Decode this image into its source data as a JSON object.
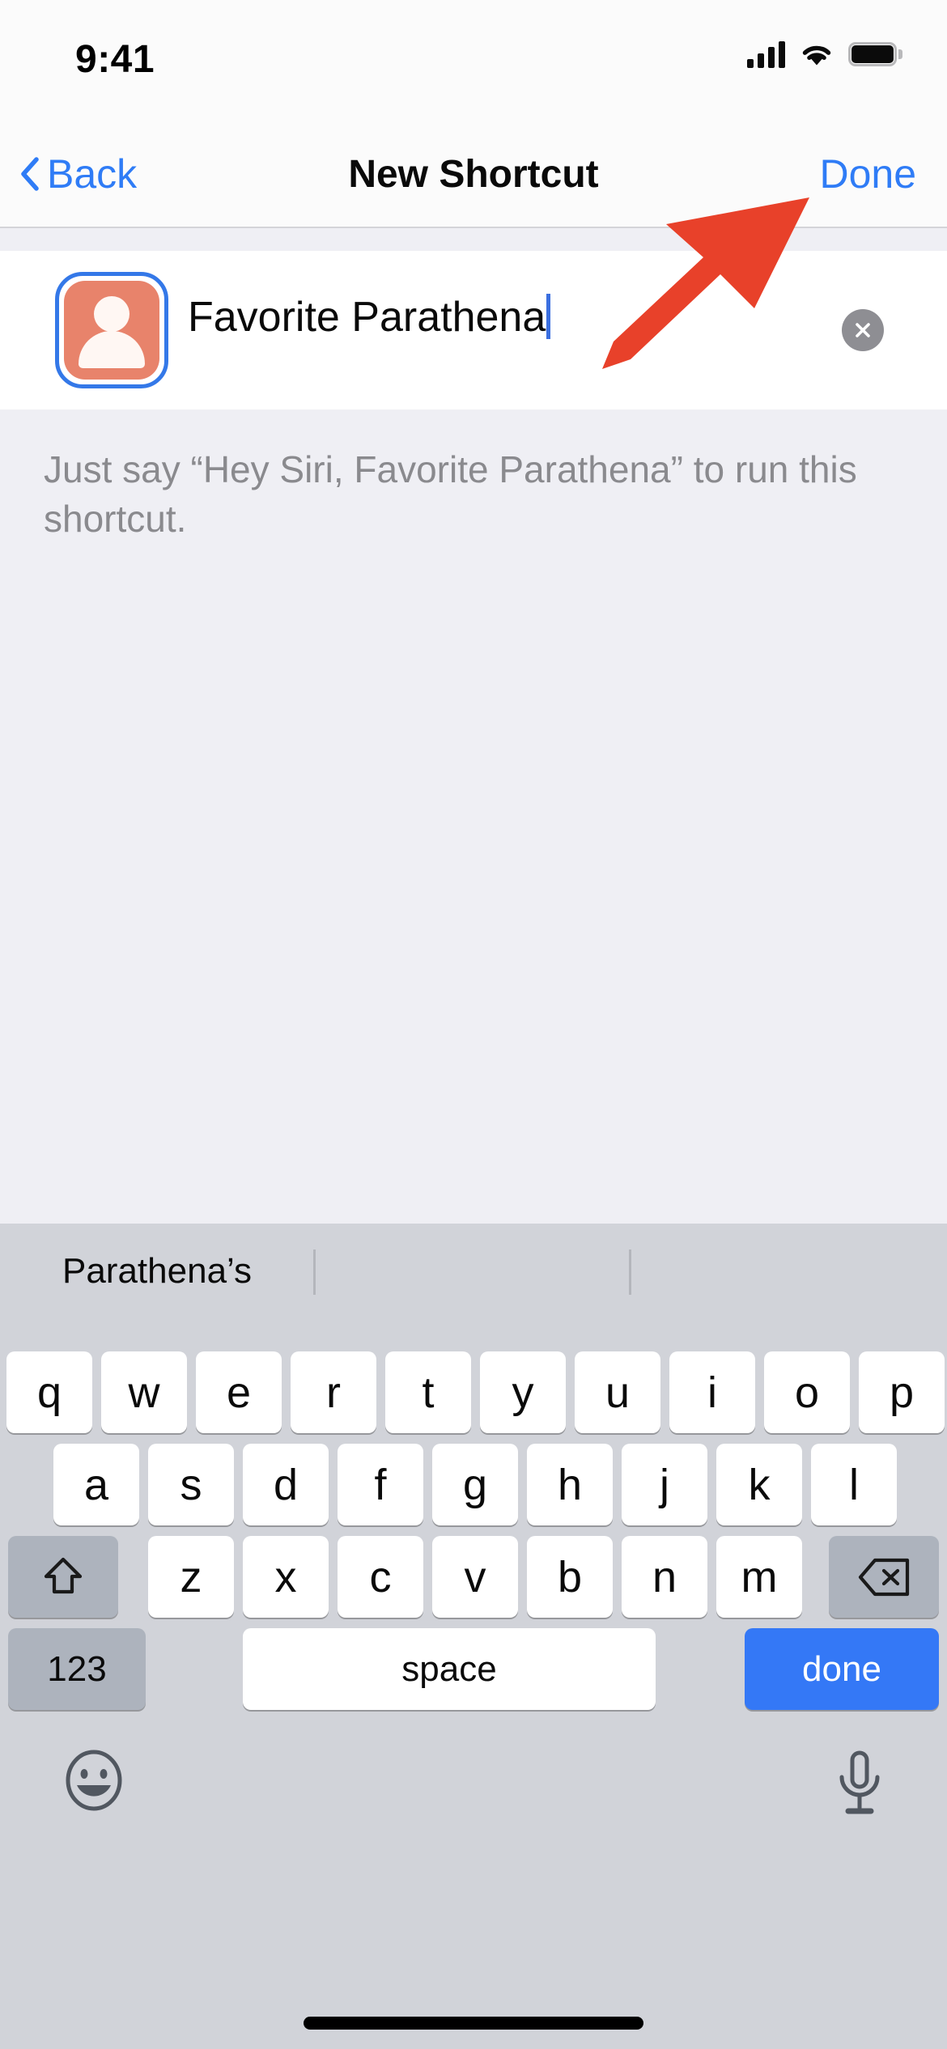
{
  "status_bar": {
    "time": "9:41",
    "signal_icon": "cellular-signal-icon",
    "wifi_icon": "wifi-icon",
    "battery_icon": "battery-full-icon"
  },
  "nav_bar": {
    "back_label": "Back",
    "back_icon": "chevron-left-icon",
    "title": "New Shortcut",
    "done_label": "Done",
    "accent_color": "#2F7CF6"
  },
  "name_field": {
    "icon_name": "contact-person-icon",
    "icon_bg_color": "#E8836B",
    "icon_selection_color": "#3478E8",
    "value": "Favorite Parathena",
    "placeholder": "Shortcut Name",
    "clear_icon": "clear-circle-icon"
  },
  "hint": {
    "text": "Just say “Hey Siri, Favorite Parathena” to run this shortcut."
  },
  "annotation": {
    "arrow_color": "#E8412A",
    "arrow_name": "red-arrow-pointing-to-done"
  },
  "keyboard": {
    "predictions": [
      "Parathena’s",
      "",
      ""
    ],
    "row1": [
      "q",
      "w",
      "e",
      "r",
      "t",
      "y",
      "u",
      "i",
      "o",
      "p"
    ],
    "row2": [
      "a",
      "s",
      "d",
      "f",
      "g",
      "h",
      "j",
      "k",
      "l"
    ],
    "row3": [
      "z",
      "x",
      "c",
      "v",
      "b",
      "n",
      "m"
    ],
    "shift_icon": "shift-arrow-icon",
    "backspace_icon": "backspace-delete-icon",
    "numbers_label": "123",
    "space_label": "space",
    "return_label": "done",
    "emoji_icon": "emoji-smiley-icon",
    "dictation_icon": "microphone-icon",
    "return_key_color": "#3478F6"
  },
  "home_indicator": {
    "name": "home-indicator-bar"
  }
}
